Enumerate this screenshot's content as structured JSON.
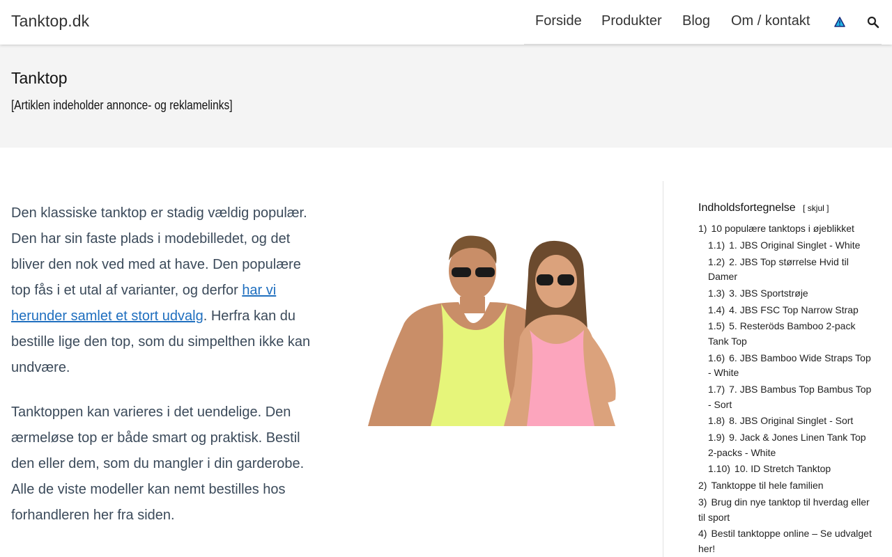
{
  "header": {
    "logo": "Tanktop.dk",
    "nav": [
      "Forside",
      "Produkter",
      "Blog",
      "Om / kontakt"
    ],
    "icons": [
      "triangle-warning-icon",
      "search-icon"
    ]
  },
  "hero": {
    "title": "Tanktop",
    "subtitle": "[Artiklen indeholder annonce- og reklamelinks]"
  },
  "content": {
    "p1_before_link": "Den klassiske tanktop er stadig vældig populær. Den har sin faste plads i modebilledet, og det bliver den nok ved med at have. Den populære top fås i et utal af varianter, og derfor ",
    "p1_link": "har vi herunder samlet et stort udvalg",
    "p1_after_link": ". Herfra kan du bestille lige den top, som du simpelthen ikke kan undvære.",
    "p2": "Tanktoppen kan varieres i det uendelige. Den ærmeløse top er både smart og praktisk. Bestil den eller dem, som du mangler i din garderobe. Alle de viste modeller kan nemt bestilles hos forhandleren her fra siden."
  },
  "toc": {
    "title": "Indholdsfortegnelse",
    "toggle_open": "[",
    "toggle_label": "skjul",
    "toggle_close": "]",
    "items": [
      {
        "num": "1)",
        "label": "10 populære tanktops i øjeblikket",
        "level": 1
      },
      {
        "num": "1.1)",
        "label": "1. JBS Original Singlet - White",
        "level": 2
      },
      {
        "num": "1.2)",
        "label": "2. JBS Top størrelse Hvid til Damer",
        "level": 2
      },
      {
        "num": "1.3)",
        "label": "3. JBS Sportstrøje",
        "level": 2
      },
      {
        "num": "1.4)",
        "label": "4. JBS FSC Top Narrow Strap",
        "level": 2
      },
      {
        "num": "1.5)",
        "label": "5. Resteröds Bamboo 2-pack Tank Top",
        "level": 2
      },
      {
        "num": "1.6)",
        "label": "6. JBS Bamboo Wide Straps Top - White",
        "level": 2
      },
      {
        "num": "1.7)",
        "label": "7. JBS Bambus Top Bambus Top - Sort",
        "level": 2
      },
      {
        "num": "1.8)",
        "label": "8. JBS Original Singlet - Sort",
        "level": 2
      },
      {
        "num": "1.9)",
        "label": "9. Jack & Jones Linen Tank Top 2-packs - White",
        "level": 2
      },
      {
        "num": "1.10)",
        "label": "10. ID Stretch Tanktop",
        "level": 2
      },
      {
        "num": "2)",
        "label": "Tanktoppe til hele familien",
        "level": 1
      },
      {
        "num": "3)",
        "label": "Brug din nye tanktop til hverdag eller til sport",
        "level": 1
      },
      {
        "num": "4)",
        "label": "Bestil tanktoppe online – Se udvalget her!",
        "level": 1
      }
    ]
  },
  "colors": {
    "link": "#1f6fbf",
    "hero_bg": "#f4f4f4",
    "body_text": "#3b4a5a",
    "tank_yellow": "#e6f57a",
    "tank_pink": "#fca5bd"
  }
}
